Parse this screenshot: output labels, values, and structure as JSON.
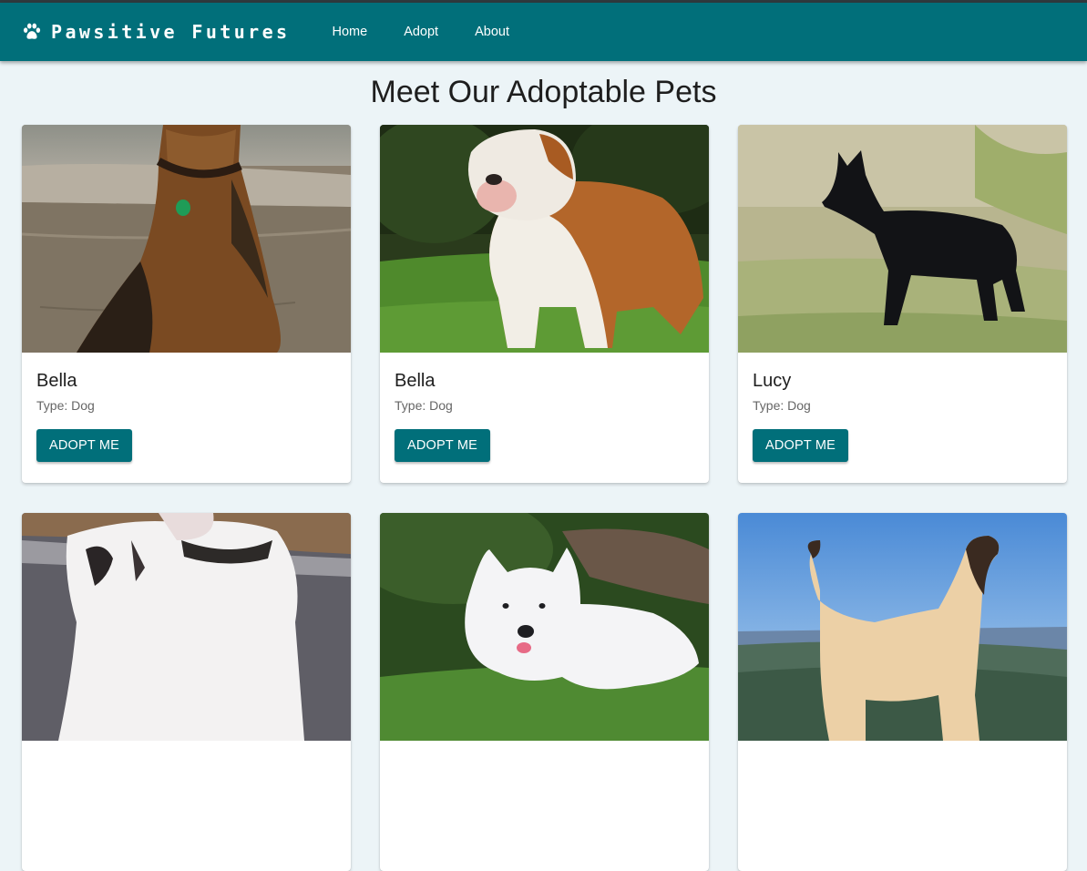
{
  "navbar": {
    "brand": "Pawsitive Futures",
    "brand_icon": "paw-icon",
    "links": [
      {
        "label": "Home"
      },
      {
        "label": "Adopt"
      },
      {
        "label": "About"
      }
    ]
  },
  "page": {
    "title": "Meet Our Adoptable Pets"
  },
  "colors": {
    "accent": "#016f7a",
    "background": "#ecf4f7"
  },
  "pets": [
    {
      "name": "Bella",
      "type_label": "Type:",
      "type": "Dog",
      "button": "ADOPT ME",
      "photo": "airedale-terrier-on-beach"
    },
    {
      "name": "Bella",
      "type_label": "Type:",
      "type": "Dog",
      "button": "ADOPT ME",
      "photo": "english-bulldog-on-grass"
    },
    {
      "name": "Lucy",
      "type_label": "Type:",
      "type": "Dog",
      "button": "ADOPT ME",
      "photo": "black-schipperke-in-field"
    },
    {
      "photo": "white-american-bulldog-on-road"
    },
    {
      "photo": "white-spitz-lying-on-grass"
    },
    {
      "photo": "afghan-hound-with-sky"
    }
  ]
}
